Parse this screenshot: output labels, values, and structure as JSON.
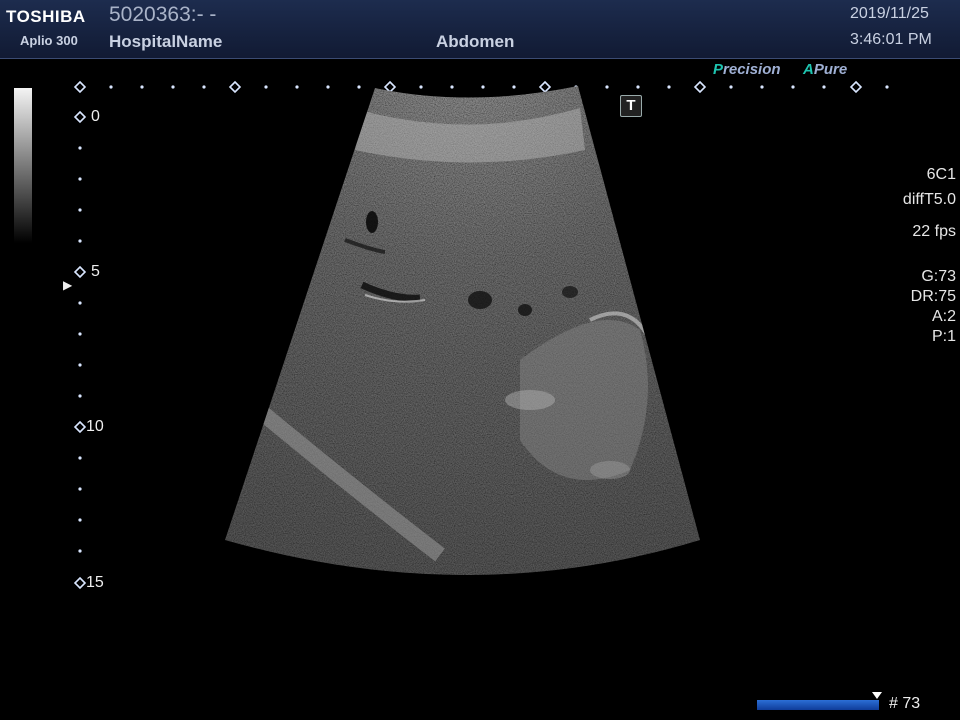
{
  "header": {
    "brand": "TOSHIBA",
    "model": "Aplio 300",
    "patient_id": "5020363:- -",
    "hospital": "HospitalName",
    "exam": "Abdomen",
    "date": "2019/11/25",
    "time": "3:46:01 PM"
  },
  "features": {
    "precision_prefix": "P",
    "precision_rest": "recision",
    "apure_prefix": "A",
    "apure_rest": "Pure"
  },
  "depth_scale": {
    "labels": [
      "0",
      "5",
      "10",
      "15"
    ],
    "focus_marker": "▶"
  },
  "overlay": {
    "t_marker": "T"
  },
  "params": {
    "probe": "6C1",
    "mode": "diffT5.0",
    "fps": "22 fps",
    "gain": "G:73",
    "dynamic_range": "DR:75",
    "a": "A:2",
    "p": "P:1"
  },
  "cine": {
    "frame_label": "# 73"
  },
  "colors": {
    "header_bg": "#17223f",
    "feature_accent": "#1ec4b0",
    "cine_bar": "#2b6fd6"
  }
}
